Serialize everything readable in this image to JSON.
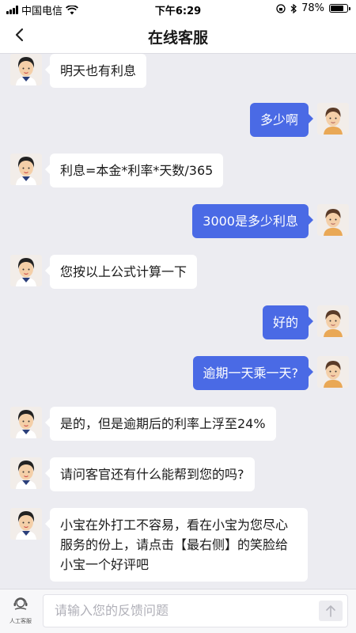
{
  "status_bar": {
    "carrier": "中国电信",
    "time": "下午6:29",
    "battery": "78%",
    "battery_level": 0.78
  },
  "nav": {
    "title": "在线客服"
  },
  "messages": [
    {
      "side": "in",
      "text": "明天也有利息"
    },
    {
      "side": "out",
      "text": "多少啊"
    },
    {
      "side": "in",
      "text": "利息=本金*利率*天数/365"
    },
    {
      "side": "out",
      "text": "3000是多少利息"
    },
    {
      "side": "in",
      "text": "您按以上公式计算一下"
    },
    {
      "side": "out",
      "text": "好的"
    },
    {
      "side": "out",
      "text": "逾期一天乘一天?"
    },
    {
      "side": "in",
      "text": "是的，但是逾期后的利率上浮至24%"
    },
    {
      "side": "in",
      "text": "请问客官还有什么能帮到您的吗?"
    },
    {
      "side": "in",
      "text": "小宝在外打工不容易，看在小宝为您尽心服务的份上，请点击【最右侧】的笑脸给小宝一个好评吧"
    }
  ],
  "bottom": {
    "agent_label": "人工客服",
    "input_placeholder": "请输入您的反馈问题"
  },
  "colors": {
    "out_bubble": "#4a6ae5",
    "in_bubble": "#ffffff",
    "background": "#ececf1"
  }
}
